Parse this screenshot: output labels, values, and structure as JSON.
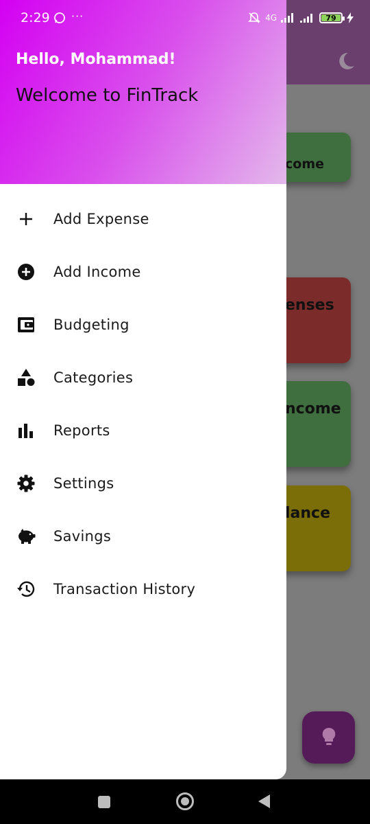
{
  "status_bar": {
    "time": "2:29",
    "dots": "···",
    "network": "4G",
    "battery": "79"
  },
  "background": {
    "cards": [
      {
        "partial_text": "come",
        "color": "#3f6e3f"
      },
      {
        "partial_text": "enses",
        "color": "#7c2b2b"
      },
      {
        "partial_text": "ncome",
        "color": "#3f6e3f"
      },
      {
        "partial_text": "lance",
        "color": "#7b6d07"
      }
    ]
  },
  "drawer": {
    "greeting": "Hello, Mohammad!",
    "welcome": "Welcome to FinTrack",
    "menu": [
      {
        "label": "Add Expense",
        "icon": "plus-icon"
      },
      {
        "label": "Add Income",
        "icon": "add-circle-icon"
      },
      {
        "label": "Budgeting",
        "icon": "wallet-icon"
      },
      {
        "label": "Categories",
        "icon": "shapes-icon"
      },
      {
        "label": "Reports",
        "icon": "bar-chart-icon"
      },
      {
        "label": "Settings",
        "icon": "gear-icon"
      },
      {
        "label": "Savings",
        "icon": "piggy-bank-icon"
      },
      {
        "label": "Transaction History",
        "icon": "history-icon"
      }
    ]
  },
  "colors": {
    "header_gradient_start": "#d400f2",
    "header_gradient_end": "#e3b9eb",
    "fab": "#551b58"
  }
}
